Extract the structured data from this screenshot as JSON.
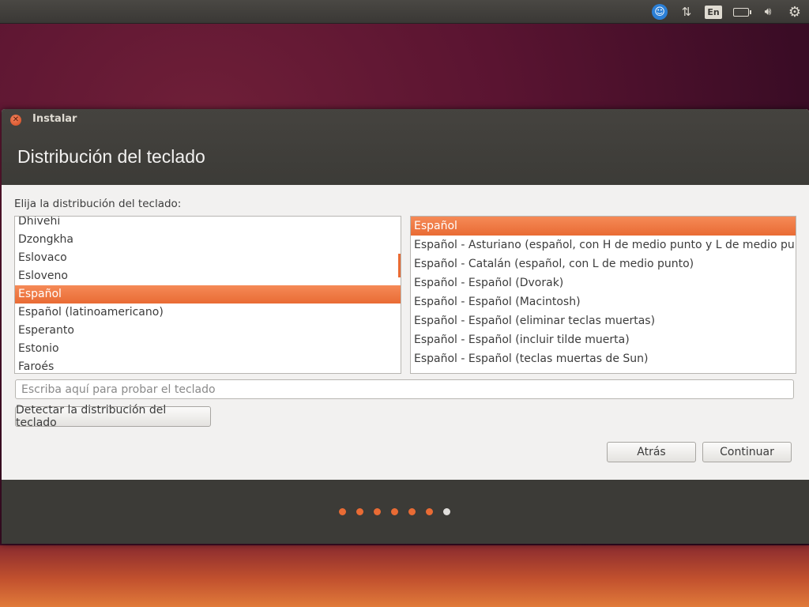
{
  "window": {
    "title": "Instalar"
  },
  "page": {
    "title": "Distribución del teclado",
    "prompt": "Elija la distribución del teclado:"
  },
  "layouts": [
    {
      "label": "Dhivehi",
      "selected": false
    },
    {
      "label": "Dzongkha",
      "selected": false
    },
    {
      "label": "Eslovaco",
      "selected": false
    },
    {
      "label": "Esloveno",
      "selected": false
    },
    {
      "label": "Español",
      "selected": true
    },
    {
      "label": "Español (latinoamericano)",
      "selected": false
    },
    {
      "label": "Esperanto",
      "selected": false
    },
    {
      "label": "Estonio",
      "selected": false
    },
    {
      "label": "Faroés",
      "selected": false
    }
  ],
  "variants": [
    {
      "label": "Español",
      "selected": true
    },
    {
      "label": "Español - Asturiano (español, con H de medio punto y L de medio punto)",
      "selected": false
    },
    {
      "label": "Español - Catalán (español, con L de medio punto)",
      "selected": false
    },
    {
      "label": "Español - Español (Dvorak)",
      "selected": false
    },
    {
      "label": "Español - Español (Macintosh)",
      "selected": false
    },
    {
      "label": "Español - Español (eliminar teclas muertas)",
      "selected": false
    },
    {
      "label": "Español - Español (incluir tilde muerta)",
      "selected": false
    },
    {
      "label": "Español - Español (teclas muertas de Sun)",
      "selected": false
    }
  ],
  "test_field": {
    "placeholder": "Escriba aquí para probar el teclado",
    "value": ""
  },
  "buttons": {
    "detect": "Detectar la distribución del teclado",
    "back": "Atrás",
    "continue": "Continuar"
  },
  "topbar": {
    "language": "En",
    "icons": [
      "accessibility-icon",
      "network-icon",
      "keyboard-language-icon",
      "battery-icon",
      "volume-icon",
      "settings-gear-icon"
    ]
  },
  "progress": {
    "total_steps": 7,
    "current_step": 7
  },
  "colors": {
    "accent": "#e96b34",
    "titlebar": "#3c3b37",
    "window_bg": "#f2f1f0"
  }
}
